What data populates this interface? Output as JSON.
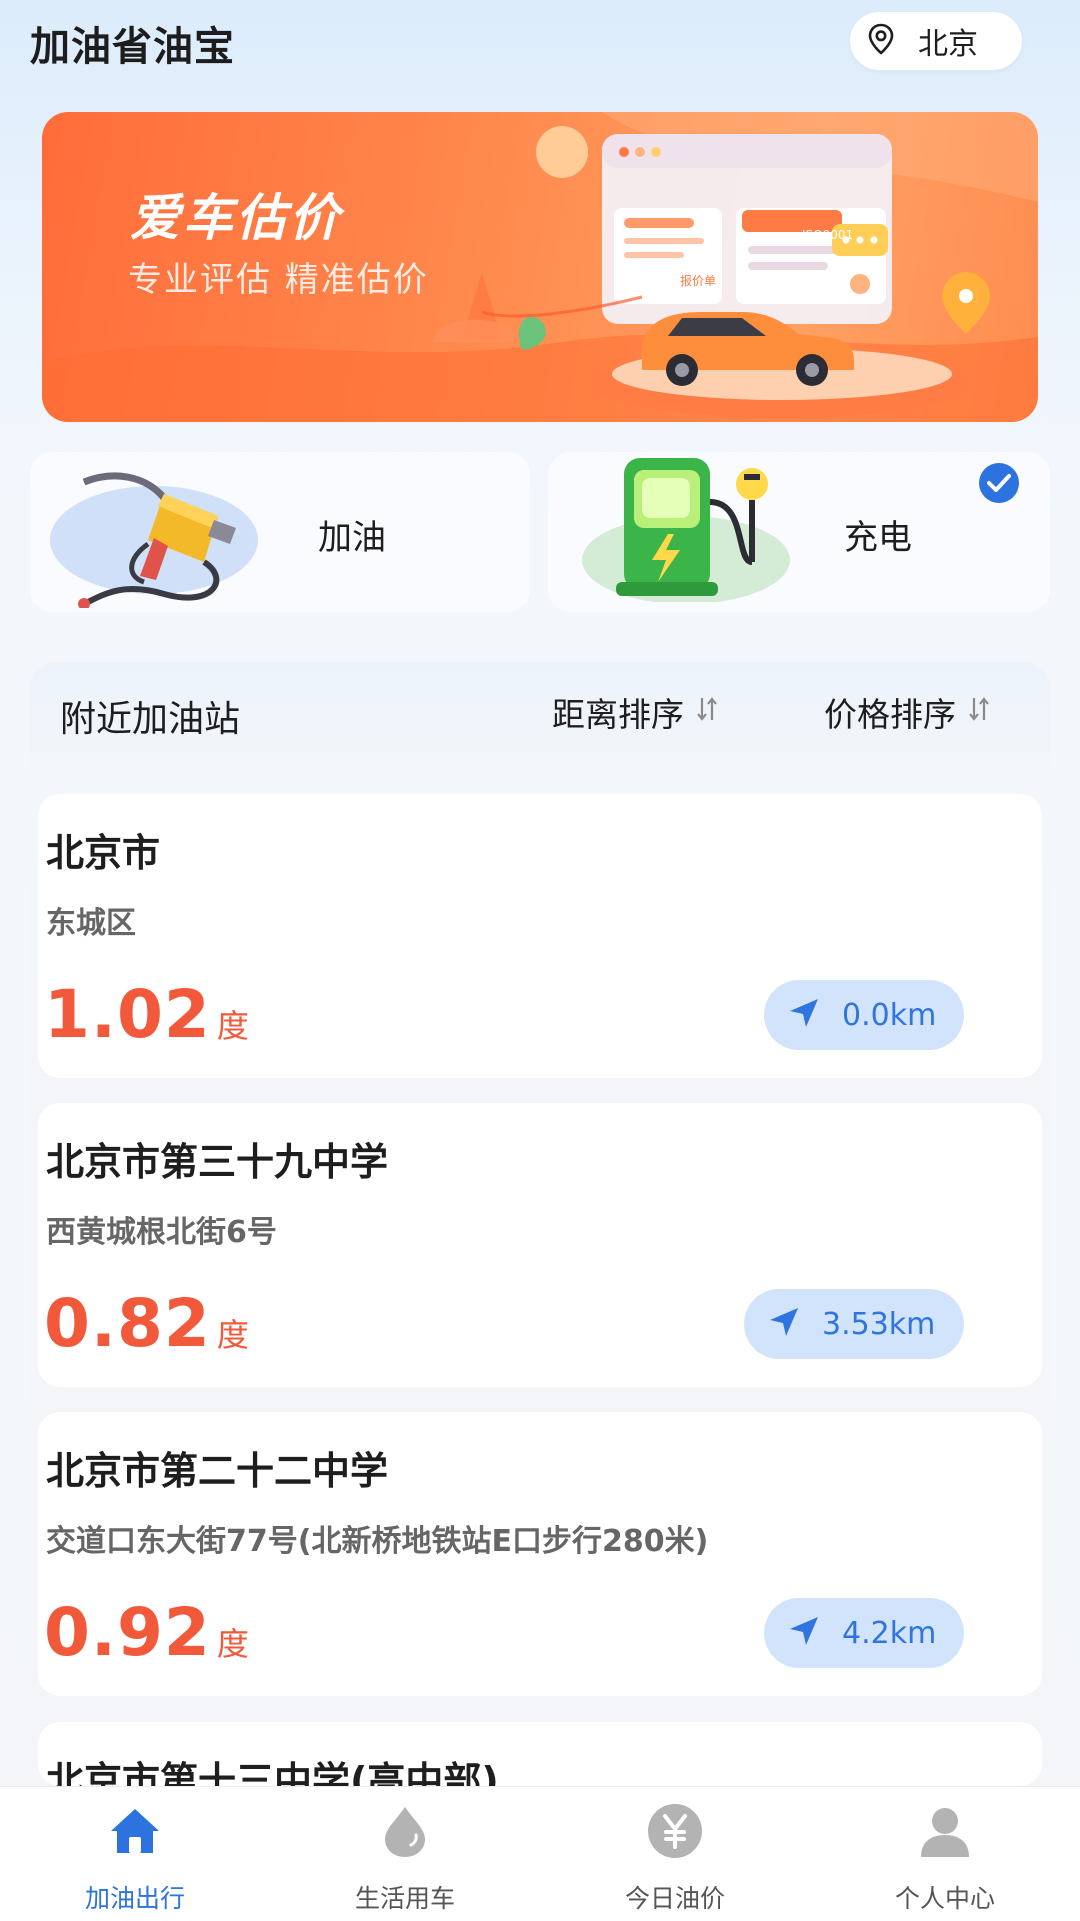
{
  "header": {
    "app_title": "加油省油宝",
    "city": "北京"
  },
  "banner": {
    "title": "爱车估价",
    "subtitle": "专业评估 精准估价",
    "tags": [
      "报价单",
      "ISO9001"
    ]
  },
  "services": [
    {
      "label": "加油",
      "selected": false
    },
    {
      "label": "充电",
      "selected": true
    }
  ],
  "nearby": {
    "title": "附近加油站",
    "sort_distance": "距离排序",
    "sort_price": "价格排序"
  },
  "stations": [
    {
      "name": "北京市",
      "address": "东城区",
      "price": "1.02",
      "unit": "度",
      "distance": "0.0km"
    },
    {
      "name": "北京市第三十九中学",
      "address": "西黄城根北街6号",
      "price": "0.82",
      "unit": "度",
      "distance": "3.53km"
    },
    {
      "name": "北京市第二十二中学",
      "address": "交道口东大街77号(北新桥地铁站E口步行280米)",
      "price": "0.92",
      "unit": "度",
      "distance": "4.2km"
    },
    {
      "name": "北京市第十三中学(高中部)"
    }
  ],
  "bottom_nav": [
    {
      "label": "加油出行",
      "icon": "home-icon",
      "active": true
    },
    {
      "label": "生活用车",
      "icon": "drop-icon",
      "active": false
    },
    {
      "label": "今日油价",
      "icon": "yen-icon",
      "active": false
    },
    {
      "label": "个人中心",
      "icon": "person-icon",
      "active": false
    }
  ],
  "colors": {
    "accent_blue": "#2c73e0",
    "price_red": "#f2583a",
    "banner_orange": "#ff7a45",
    "distance_pill": "#d2e4fb"
  }
}
